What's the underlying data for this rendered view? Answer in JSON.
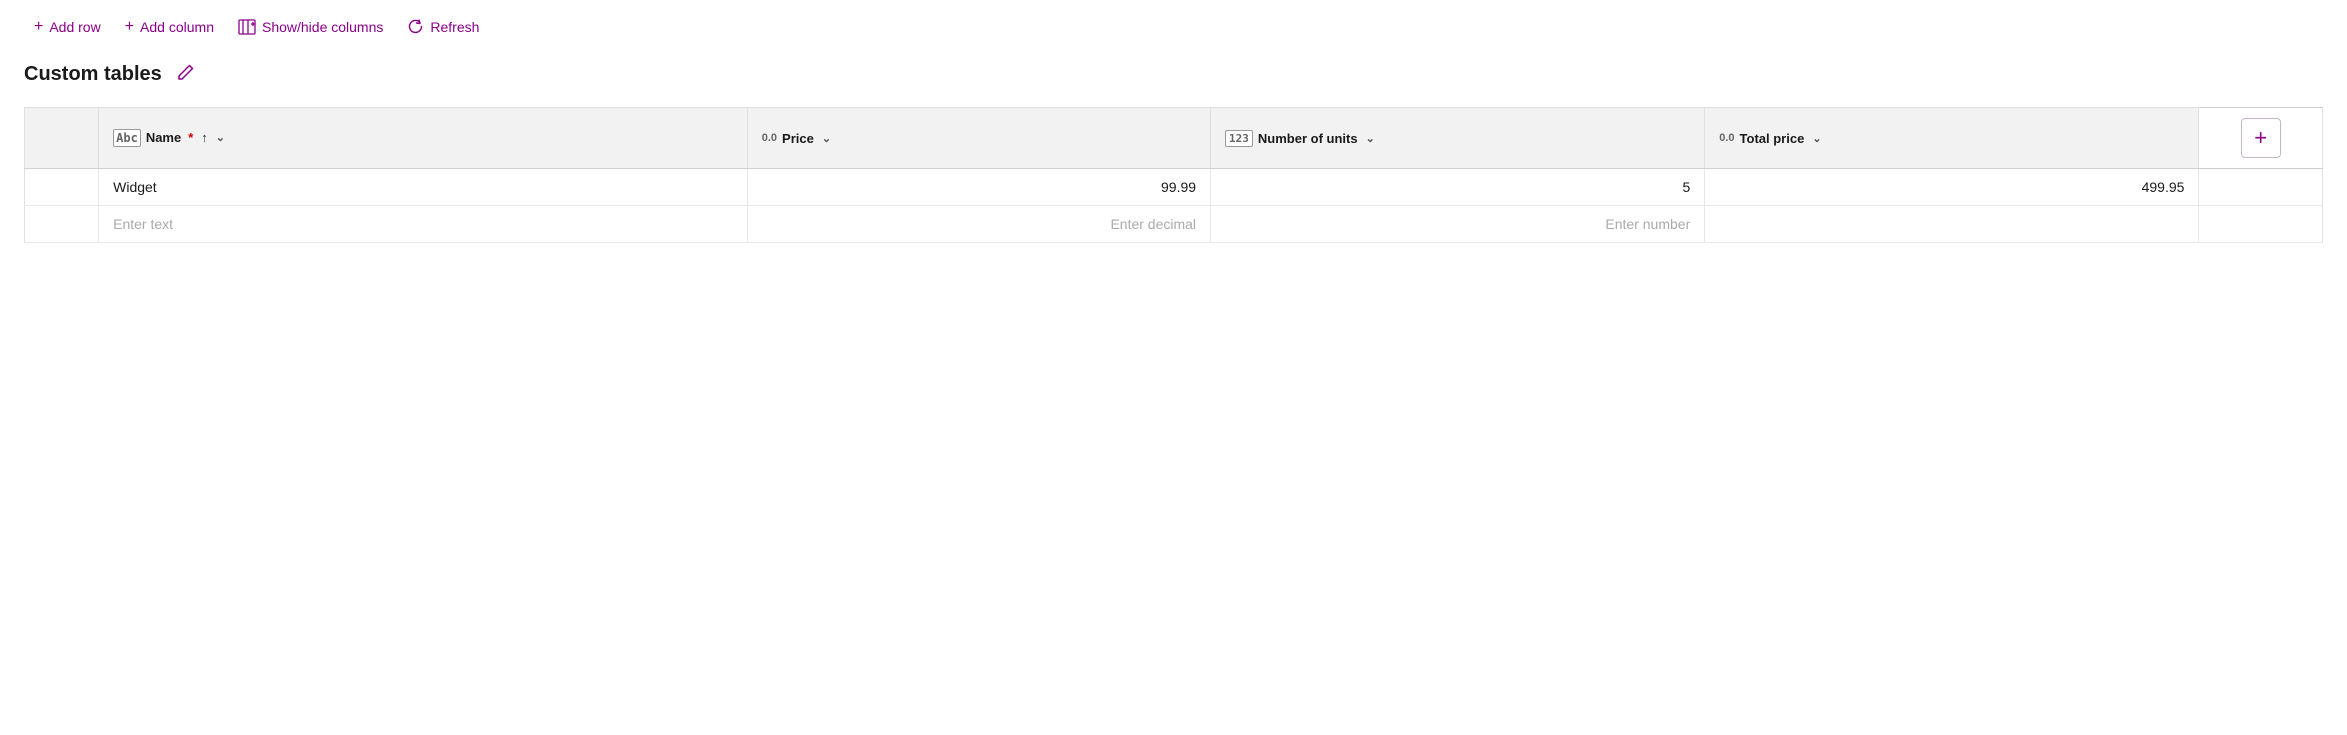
{
  "toolbar": {
    "add_row_label": "Add row",
    "add_column_label": "Add column",
    "show_hide_label": "Show/hide columns",
    "refresh_label": "Refresh"
  },
  "page": {
    "title": "Custom tables",
    "edit_icon": "✏"
  },
  "table": {
    "columns": [
      {
        "id": "name",
        "icon_type": "abc",
        "icon_label": "Abc",
        "label": "Name",
        "required": true,
        "sorted": true,
        "sort_direction": "asc",
        "has_chevron": false
      },
      {
        "id": "price",
        "icon_type": "decimal",
        "icon_label": "0.0",
        "label": "Price",
        "required": false,
        "sorted": false,
        "has_chevron": true
      },
      {
        "id": "units",
        "icon_type": "number",
        "icon_label": "123",
        "label": "Number of units",
        "required": false,
        "sorted": false,
        "has_chevron": true
      },
      {
        "id": "total",
        "icon_type": "decimal",
        "icon_label": "0.0",
        "label": "Total price",
        "required": false,
        "sorted": false,
        "has_chevron": true
      }
    ],
    "rows": [
      {
        "name": "Widget",
        "price": "99.99",
        "units": "5",
        "total": "499.95"
      }
    ],
    "empty_row": {
      "name_placeholder": "Enter text",
      "price_placeholder": "Enter decimal",
      "units_placeholder": "Enter number",
      "total_placeholder": ""
    },
    "add_column_btn_label": "+"
  },
  "colors": {
    "accent": "#8b008b",
    "required": "#cc0000",
    "header_bg": "#f2f2f2",
    "border": "#e0e0e0"
  }
}
